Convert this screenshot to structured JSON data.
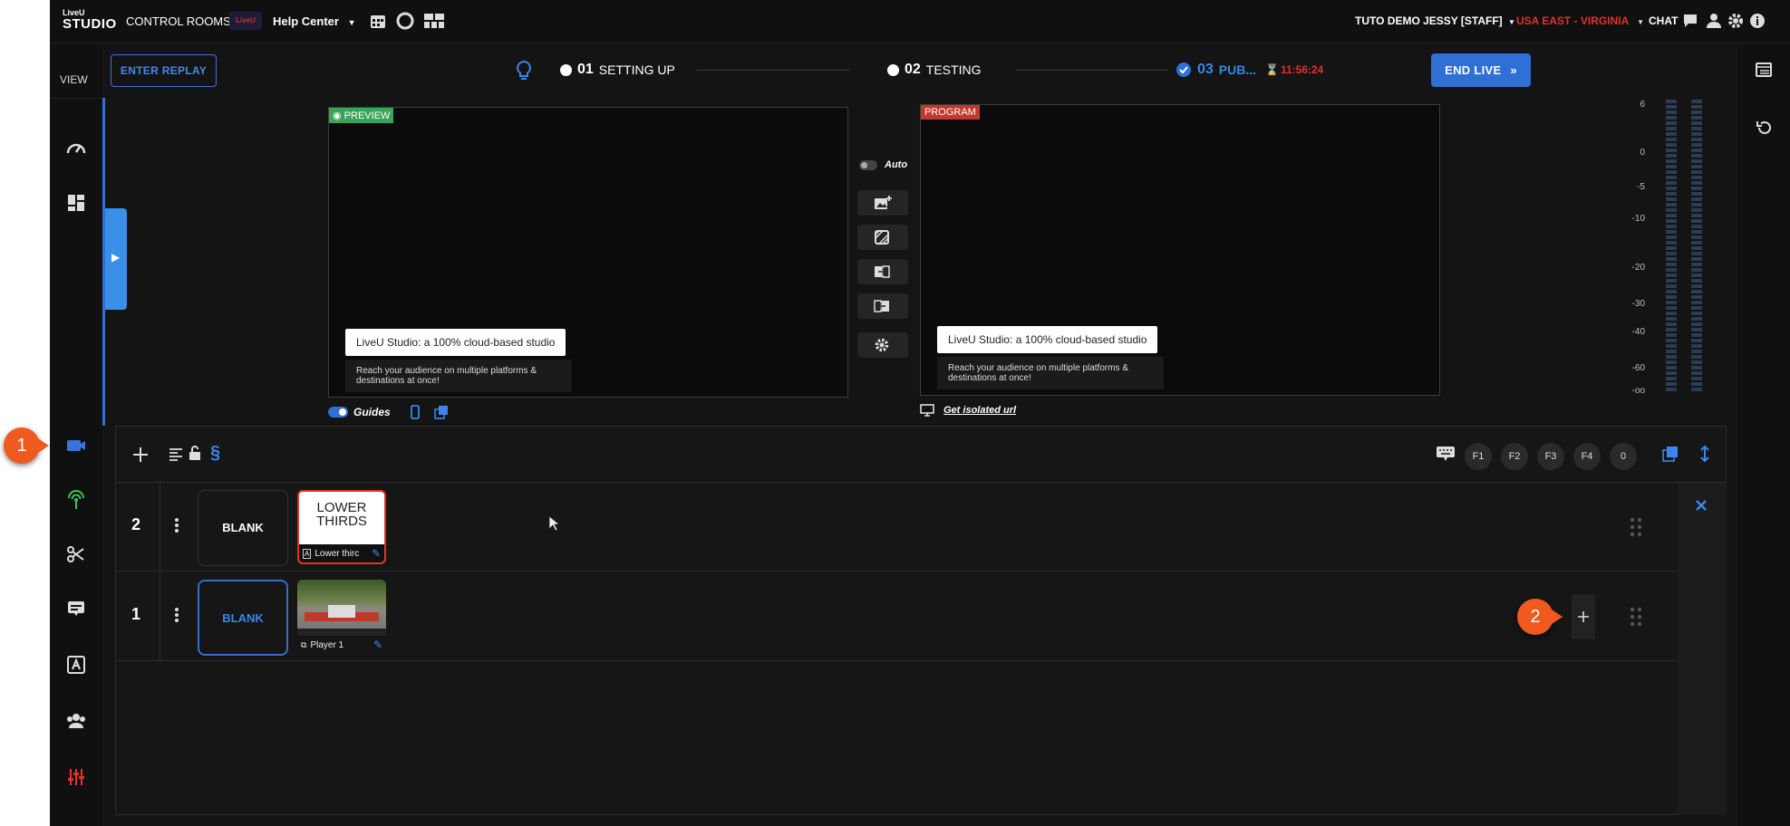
{
  "topbar": {
    "logo_top": "LiveU",
    "logo_bottom": "STUDIO",
    "control_rooms": "CONTROL ROOMS",
    "help_center": "Help Center",
    "user": "TUTO DEMO JESSY [STAFF]",
    "region": "USA EAST - VIRGINIA",
    "chat": "CHAT"
  },
  "sidebar": {
    "view_label": "VIEW"
  },
  "workflow": {
    "replay_button": "ENTER REPLAY",
    "steps": [
      {
        "num": "01",
        "label": "SETTING UP"
      },
      {
        "num": "02",
        "label": "TESTING"
      },
      {
        "num": "03",
        "label": "PUB..."
      }
    ],
    "timer": "11:56:24",
    "end_button": "END LIVE"
  },
  "preview": {
    "tag": "PREVIEW",
    "lt_title": "LiveU Studio: a 100% cloud-based studio",
    "lt_sub": "Reach your audience on multiple platforms & destinations at once!",
    "guides_label": "Guides"
  },
  "program": {
    "tag": "PROGRAM",
    "lt_title": "LiveU Studio: a 100% cloud-based studio",
    "lt_sub": "Reach your audience on multiple platforms & destinations at once!",
    "isolated_url": "Get isolated url"
  },
  "auto_label": "Auto",
  "meter_scale": [
    "6",
    "0",
    "-5",
    "-10",
    "-20",
    "-30",
    "-40",
    "-60",
    "-oo"
  ],
  "fkeys": [
    "F1",
    "F2",
    "F3",
    "F4",
    "0"
  ],
  "layers": [
    {
      "num": "2",
      "blank": "BLANK",
      "source_title_1": "LOWER",
      "source_title_2": "THIRDS",
      "source_label": "Lower thirc"
    },
    {
      "num": "1",
      "blank": "BLANK",
      "source_label": "Player 1"
    }
  ],
  "callouts": [
    "1",
    "2"
  ],
  "colors": {
    "accent": "#3a74d8",
    "live_red": "#e53935",
    "preview_green": "#3aa35a",
    "callout": "#f05a1e"
  }
}
